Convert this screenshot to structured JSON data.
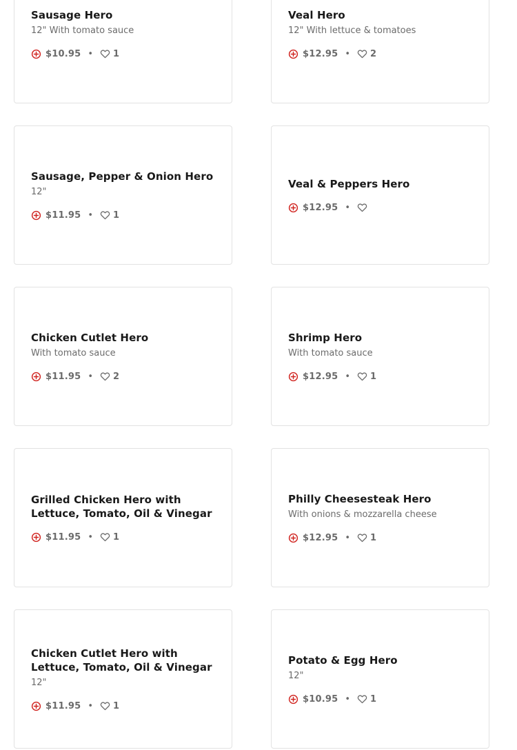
{
  "colors": {
    "accent": "#d0211d",
    "text_primary": "#191919",
    "text_secondary": "#6b6b6b",
    "card_border": "#e2e2e2"
  },
  "icons": {
    "add": "plus-circle-icon",
    "like": "heart-outline-icon"
  },
  "menu_items": [
    {
      "name": "Sausage Hero",
      "description": "12\" With tomato sauce",
      "price": "$10.95",
      "likes": "1"
    },
    {
      "name": "Veal Hero",
      "description": "12\" With lettuce & tomatoes",
      "price": "$12.95",
      "likes": "2"
    },
    {
      "name": "Sausage, Pepper & Onion Hero",
      "description": "12\"",
      "price": "$11.95",
      "likes": "1"
    },
    {
      "name": "Veal & Peppers Hero",
      "description": "",
      "price": "$12.95",
      "likes": ""
    },
    {
      "name": "Chicken Cutlet Hero",
      "description": "With tomato sauce",
      "price": "$11.95",
      "likes": "2"
    },
    {
      "name": "Shrimp Hero",
      "description": "With tomato sauce",
      "price": "$12.95",
      "likes": "1"
    },
    {
      "name": "Grilled Chicken Hero with Lettuce, Tomato, Oil & Vinegar",
      "description": "",
      "price": "$11.95",
      "likes": "1"
    },
    {
      "name": "Philly Cheesesteak Hero",
      "description": "With onions & mozzarella cheese",
      "price": "$12.95",
      "likes": "1"
    },
    {
      "name": "Chicken Cutlet Hero with Lettuce, Tomato, Oil & Vinegar",
      "description": "12\"",
      "price": "$11.95",
      "likes": "1"
    },
    {
      "name": "Potato & Egg Hero",
      "description": "12\"",
      "price": "$10.95",
      "likes": "1"
    }
  ],
  "separator": "•"
}
